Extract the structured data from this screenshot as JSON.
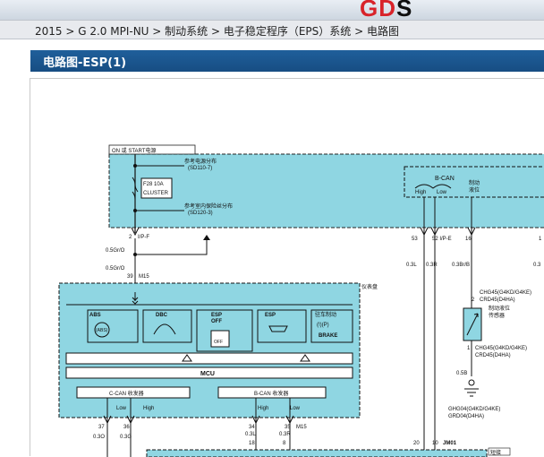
{
  "header": {
    "logo_accent": "GD",
    "logo_tail": "S"
  },
  "breadcrumb": "2015 > G 2.0 MPI-NU > 制动系统 > 电子稳定程序（EPS）系统 > 电路图",
  "section_title": "电路图-ESP(1)",
  "diagram": {
    "power_tag": "ON 或 START电源",
    "ref_power": "参考电源分布",
    "ref_power_code": "(SD110-7)",
    "fuse_label": "F28 10A",
    "fuse_sub": "CLUSTER",
    "ref_fuse": "参考室内保险丝分布",
    "ref_fuse_code": "(SD120-3)",
    "pin_ipf_num": "2",
    "pin_ipf_name": "I/P-F",
    "wire_05gro_1": "0.5Gr/O",
    "wire_05gro_2": "0.5Gr/O",
    "pin_m15_num": "39",
    "pin_m15_name": "M15",
    "cluster_label": "仪表盘",
    "ind_abs": "ABS",
    "ind_dbc": "DBC",
    "ind_esp_off_1": "ESP",
    "ind_esp_off_2": "OFF",
    "ind_esp": "ESP",
    "ind_brake_title": "驻车制动",
    "ind_brake_icon": "(!)(P)",
    "ind_brake": "BRAKE",
    "abs_icon": "(ABS)",
    "off_icon": "OFF",
    "mcu": "MCU",
    "ccan": "C-CAN 收发器",
    "bcan_tx": "B-CAN 收发器",
    "low1": "Low",
    "high1": "High",
    "high2": "High",
    "low2": "Low",
    "bcan_label": "B-CAN",
    "bcan_high": "High",
    "bcan_low": "Low",
    "brake_fluid_1": "制动",
    "brake_fluid_2": "液位",
    "pin53": "53",
    "pin52_ipe": "52 I/P-E",
    "pin16": "16",
    "pin_edge": "1",
    "w03l_a": "0.3L",
    "w03r_a": "0.3R",
    "w03brb": "0.3Br/B",
    "w03_edge": "0.3",
    "chg_top_1": "CHG45(G4KD/G4KE)",
    "chg_top_2_num": "2",
    "chg_top_2": "CRD45(D4HA)",
    "sensor_1": "制动液位",
    "sensor_2": "传感器",
    "chg_bot_1_num": "1",
    "chg_bot_1": "CHG45(G4KD/G4KE)",
    "chg_bot_2": "CRD45(D4HA)",
    "w05b": "0.5B",
    "gnd_1": "GHG04(G4KD/G4KE)",
    "gnd_2": "GRD04(D4HA)",
    "p37": "37",
    "p36": "36",
    "p34": "34",
    "p35": "35",
    "p35_name": "M15",
    "w03o": "0.3O",
    "w03g": "0.3G",
    "w03l_b": "0.3L",
    "w03r_b": "0.3R",
    "p18": "18",
    "p8": "8",
    "p20": "20",
    "p10": "10",
    "jm01": "JM01",
    "connector_label": "短接"
  }
}
